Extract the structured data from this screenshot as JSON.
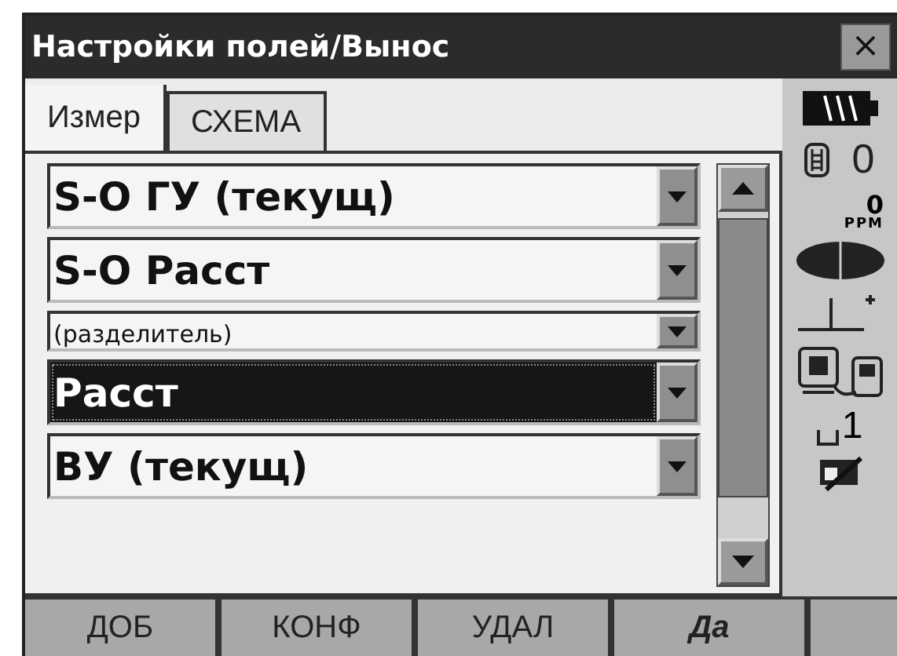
{
  "window": {
    "title": "Настройки полей/Вынос",
    "close": "×"
  },
  "tabs": [
    {
      "label": "Измер",
      "selected": true
    },
    {
      "label": "СХЕМА",
      "selected": false
    }
  ],
  "fields": [
    {
      "value": "S-O ГУ (текущ)",
      "kind": "normal",
      "selected": false
    },
    {
      "value": "S-O Расст",
      "kind": "normal",
      "selected": false
    },
    {
      "value": "(разделитель)",
      "kind": "separator",
      "selected": false
    },
    {
      "value": "Расст",
      "kind": "normal",
      "selected": true
    },
    {
      "value": "ВУ (текущ)",
      "kind": "normal",
      "selected": false
    }
  ],
  "status": {
    "prism_constant": "0",
    "ppm_value": "0",
    "ppm_unit": "PPM",
    "target_number": "1"
  },
  "softkeys": [
    {
      "label": "ДОБ",
      "default": false
    },
    {
      "label": "КОНФ",
      "default": false
    },
    {
      "label": "УДАЛ",
      "default": false
    },
    {
      "label": "Да",
      "default": true
    }
  ]
}
